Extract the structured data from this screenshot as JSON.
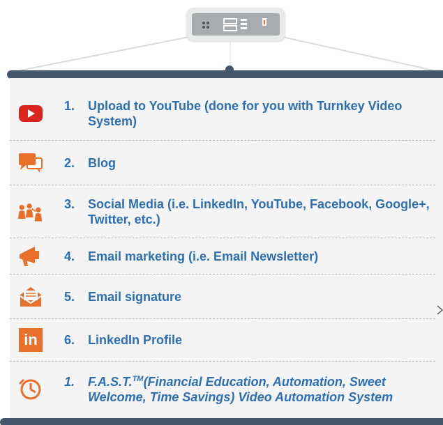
{
  "items": [
    {
      "number": "1.",
      "label": "Upload to YouTube (done for you with Turnkey Video System)",
      "icon": "youtube-icon"
    },
    {
      "number": "2.",
      "label": "Blog",
      "icon": "blog-speech-bubble-icon"
    },
    {
      "number": "3.",
      "label": "Social Media (i.e. LinkedIn, YouTube, Facebook, Google+, Twitter, etc.)",
      "icon": "social-media-people-icon"
    },
    {
      "number": "4.",
      "label": "Email marketing (i.e. Email Newsletter)",
      "icon": "megaphone-icon"
    },
    {
      "number": "5.",
      "label": "Email signature",
      "icon": "email-envelope-icon"
    },
    {
      "number": "6.",
      "label": "LinkedIn Profile",
      "icon": "linkedin-icon",
      "icon_text": "in"
    },
    {
      "number": "1.",
      "label_prefix": "F.A.S.T.",
      "label_sup": "TM",
      "label": "(Financial Education, Automation, Sweet Welcome, Time Savings) Video Automation System",
      "icon": "clock-icon"
    }
  ],
  "colors": {
    "text": "#2c6fb3",
    "rod": "#44576a",
    "board": "#f4f4f4",
    "icon_orange": "#e8702a",
    "youtube_red": "#d9251d"
  }
}
